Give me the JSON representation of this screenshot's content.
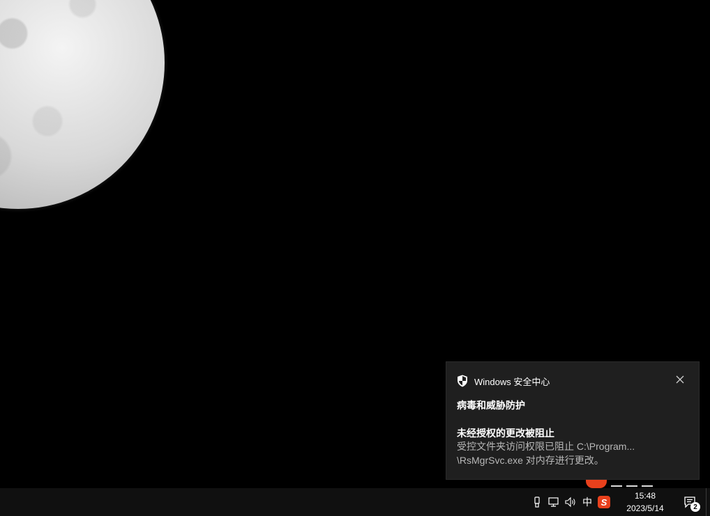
{
  "toast": {
    "app_name": "Windows 安全中心",
    "title": "病毒和威胁防护",
    "subtitle": "未经授权的更改被阻止",
    "body_line1": "受控文件夹访问权限已阻止 C:\\Program...",
    "body_line2": "\\RsMgrSvc.exe 对内存进行更改。",
    "icons": {
      "app": "shield-icon",
      "close": "close-icon"
    }
  },
  "taskbar": {
    "tray_icons": [
      "usb-icon",
      "network-icon",
      "volume-icon"
    ],
    "ime_label": "中",
    "sogou_label": "S",
    "clock_time": "15:48",
    "clock_date": "2023/5/14",
    "notification_count": "2"
  },
  "colors": {
    "desktop_bg": "#000000",
    "toast_bg": "#1f1f1f",
    "taskbar_bg": "#101010",
    "sogou_brand": "#e8401c"
  }
}
